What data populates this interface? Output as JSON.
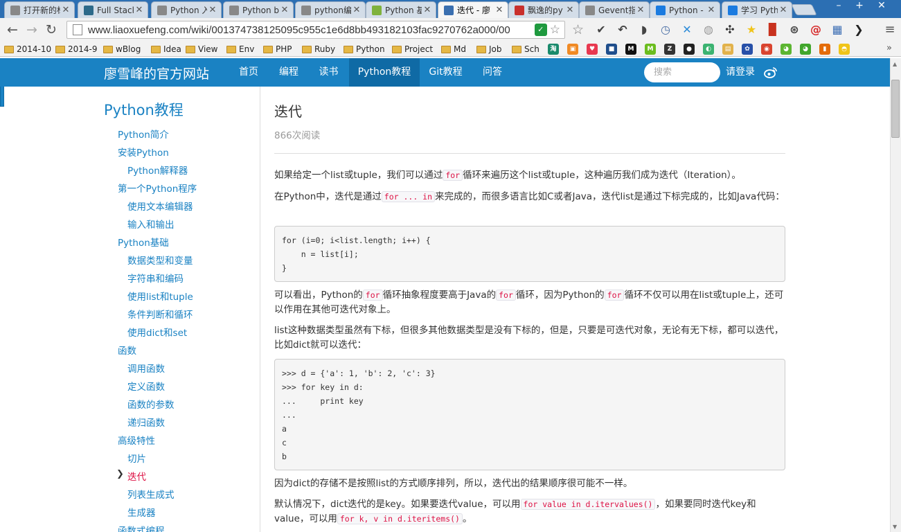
{
  "browser": {
    "tabs": [
      {
        "title": "打开新的标",
        "icon": "blank-page-icon",
        "color": "#888888"
      },
      {
        "title": "Full Stack",
        "icon": "grid-icon",
        "color": "#2d6a8a"
      },
      {
        "title": "Python 入",
        "icon": "page-icon",
        "color": "#888888"
      },
      {
        "title": "Python b",
        "icon": "page-icon",
        "color": "#888888"
      },
      {
        "title": "python编",
        "icon": "page-icon",
        "color": "#888888"
      },
      {
        "title": "Python 基",
        "icon": "w3c-icon",
        "color": "#7fb23c"
      },
      {
        "title": "迭代 - 廖",
        "icon": "film-icon",
        "color": "#3a6fb0"
      },
      {
        "title": "飘逸的py",
        "icon": "csdn-icon",
        "color": "#c9302c"
      },
      {
        "title": "Gevent指",
        "icon": "page-icon",
        "color": "#888888"
      },
      {
        "title": "Python -",
        "icon": "zhihu-icon",
        "color": "#1a7be0"
      },
      {
        "title": "学习 Pyth",
        "icon": "zhihu-icon",
        "color": "#1a7be0"
      }
    ],
    "active_tab_index": 6,
    "window_controls": [
      "–",
      "+",
      "✕"
    ],
    "url": "www.liaoxuefeng.com/wiki/001374738125095c955c1e6d8bb493182103fac9270762a000/00",
    "bookmarks": [
      {
        "label": "2014-10",
        "type": "folder"
      },
      {
        "label": "2014-9",
        "type": "folder"
      },
      {
        "label": "wBlog",
        "type": "folder"
      },
      {
        "label": "Idea",
        "type": "folder"
      },
      {
        "label": "View",
        "type": "folder"
      },
      {
        "label": "Env",
        "type": "folder"
      },
      {
        "label": "PHP",
        "type": "folder"
      },
      {
        "label": "Ruby",
        "type": "folder"
      },
      {
        "label": "Python",
        "type": "folder"
      },
      {
        "label": "Project",
        "type": "folder"
      },
      {
        "label": "Md",
        "type": "folder"
      },
      {
        "label": "Job",
        "type": "folder"
      },
      {
        "label": "Sch",
        "type": "folder"
      }
    ],
    "bookmark_icons": [
      {
        "name": "taobao-icon",
        "glyph": "淘",
        "color": "#1a8a6c"
      },
      {
        "name": "orange-app-icon",
        "glyph": "▣",
        "color": "#f08a24"
      },
      {
        "name": "pocket-icon",
        "glyph": "♥",
        "color": "#e8384f"
      },
      {
        "name": "square-app-icon",
        "glyph": "■",
        "color": "#1f4e8c"
      },
      {
        "name": "m-icon",
        "glyph": "M",
        "color": "#111111"
      },
      {
        "name": "green-m-icon",
        "glyph": "M",
        "color": "#6bbd1e"
      },
      {
        "name": "slash-icon",
        "glyph": "Z",
        "color": "#333333"
      },
      {
        "name": "github-icon",
        "glyph": "●",
        "color": "#222222"
      },
      {
        "name": "leaf-icon",
        "glyph": "◐",
        "color": "#3cb371"
      },
      {
        "name": "notes-icon",
        "glyph": "▤",
        "color": "#e2b24b"
      },
      {
        "name": "paw-icon",
        "glyph": "✿",
        "color": "#2750a8"
      },
      {
        "name": "chrome-icon",
        "glyph": "◉",
        "color": "#d9442f"
      },
      {
        "name": "wechat-icon",
        "glyph": "◕",
        "color": "#5cb531"
      },
      {
        "name": "wechat-2-icon",
        "glyph": "◕",
        "color": "#41a62c"
      },
      {
        "name": "bookmark-orange-icon",
        "glyph": "▮",
        "color": "#e46c0a"
      },
      {
        "name": "yellow-app-icon",
        "glyph": "◓",
        "color": "#f0c419"
      }
    ],
    "extensions": [
      {
        "name": "check-icon",
        "glyph": "✔",
        "color": "#444444"
      },
      {
        "name": "undo-icon",
        "glyph": "↶",
        "color": "#444444"
      },
      {
        "name": "pocket-ext-icon",
        "glyph": "◗",
        "color": "#444444"
      },
      {
        "name": "clock-icon",
        "glyph": "◷",
        "color": "#4a6fa5"
      },
      {
        "name": "vscode-icon",
        "glyph": "✕",
        "color": "#2a8ad8"
      },
      {
        "name": "globe-icon",
        "glyph": "◍",
        "color": "#999999"
      },
      {
        "name": "puzzle-icon",
        "glyph": "✣",
        "color": "#333333"
      },
      {
        "name": "star-yellow-icon",
        "glyph": "★",
        "color": "#f0c419"
      },
      {
        "name": "book-red-icon",
        "glyph": "▉",
        "color": "#c8321e"
      },
      {
        "name": "steering-icon",
        "glyph": "⊛",
        "color": "#444444"
      },
      {
        "name": "at-icon",
        "glyph": "@",
        "color": "#d62a2a"
      },
      {
        "name": "doc-icon",
        "glyph": "▦",
        "color": "#3b6db3"
      },
      {
        "name": "terminal-icon",
        "glyph": "❯",
        "color": "#222222"
      }
    ]
  },
  "site": {
    "logo": "廖雪峰的官方网站",
    "nav": [
      "首页",
      "编程",
      "读书",
      "Python教程",
      "Git教程",
      "问答"
    ],
    "active_nav_index": 3,
    "search_placeholder": "搜索",
    "login": "请登录"
  },
  "sidebar": {
    "title": "Python教程",
    "items": [
      {
        "label": "Python简介",
        "level": 1
      },
      {
        "label": "安装Python",
        "level": 1
      },
      {
        "label": "Python解释器",
        "level": 2
      },
      {
        "label": "第一个Python程序",
        "level": 1
      },
      {
        "label": "使用文本编辑器",
        "level": 2
      },
      {
        "label": "输入和输出",
        "level": 2
      },
      {
        "label": "Python基础",
        "level": 1
      },
      {
        "label": "数据类型和变量",
        "level": 2
      },
      {
        "label": "字符串和编码",
        "level": 2
      },
      {
        "label": "使用list和tuple",
        "level": 2
      },
      {
        "label": "条件判断和循环",
        "level": 2
      },
      {
        "label": "使用dict和set",
        "level": 2
      },
      {
        "label": "函数",
        "level": 1
      },
      {
        "label": "调用函数",
        "level": 2
      },
      {
        "label": "定义函数",
        "level": 2
      },
      {
        "label": "函数的参数",
        "level": 2
      },
      {
        "label": "递归函数",
        "level": 2
      },
      {
        "label": "高级特性",
        "level": 1
      },
      {
        "label": "切片",
        "level": 2
      },
      {
        "label": "迭代",
        "level": 2,
        "active": true
      },
      {
        "label": "列表生成式",
        "level": 2
      },
      {
        "label": "生成器",
        "level": 2
      },
      {
        "label": "函数式编程",
        "level": 1
      }
    ]
  },
  "article": {
    "title": "迭代",
    "reads": "866次阅读",
    "p1": {
      "before": "如果给定一个list或tuple，我们可以通过",
      "code": "for",
      "after": "循环来遍历这个list或tuple，这种遍历我们成为迭代（Iteration）。"
    },
    "p2": {
      "before": "在Python中，迭代是通过",
      "code": "for ... in",
      "after": "来完成的，而很多语言比如C或者Java，迭代list是通过下标完成的，比如Java代码："
    },
    "code1": [
      "for (i=0; i<list.length; i++) {",
      "    n = list[i];",
      "}"
    ],
    "p3": {
      "a": "可以看出，Python的",
      "code1": "for",
      "b": "循环抽象程度要高于Java的",
      "code2": "for",
      "c": "循环，因为Python的",
      "code3": "for",
      "d": "循环不仅可以用在list或tuple上，还可以作用在其他可迭代对象上。"
    },
    "p4": "list这种数据类型虽然有下标，但很多其他数据类型是没有下标的，但是，只要是可迭代对象，无论有无下标，都可以迭代，比如dict就可以迭代：",
    "code2": [
      ">>> d = {'a': 1, 'b': 2, 'c': 3}",
      ">>> for key in d:",
      "...     print key",
      "...",
      "a",
      "c",
      "b"
    ],
    "p5": "因为dict的存储不是按照list的方式顺序排列，所以，迭代出的结果顺序很可能不一样。",
    "p6": {
      "a": "默认情况下，dict迭代的是key。如果要迭代value，可以用",
      "code1": "for value in d.itervalues()",
      "b": "，如果要同时迭代key和value，可以用",
      "code2": "for k, v in d.iteritems()",
      "c": "。"
    }
  }
}
